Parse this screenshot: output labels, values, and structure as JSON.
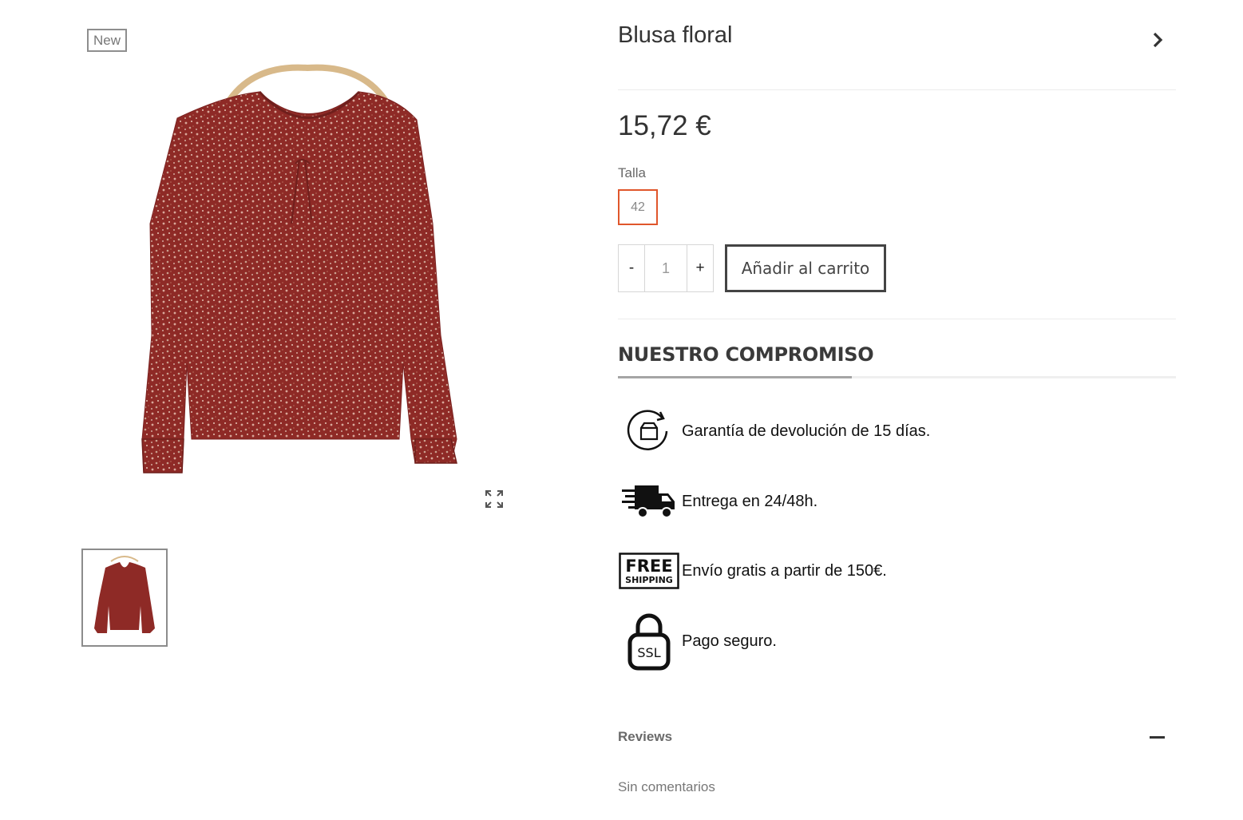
{
  "gallery": {
    "badge": "New"
  },
  "product": {
    "title": "Blusa floral",
    "price": "15,72 €",
    "size_label": "Talla",
    "sizes": [
      "42"
    ],
    "selected_size": "42",
    "quantity": {
      "minus": "-",
      "value": "1",
      "plus": "+"
    },
    "add_to_cart": "Añadir al carrito"
  },
  "commitment": {
    "title": "NUESTRO COMPROMISO",
    "items": [
      {
        "icon": "return-box-icon",
        "text": "Garantía de devolución de 15 días."
      },
      {
        "icon": "delivery-truck-icon",
        "text": "Entrega en 24/48h."
      },
      {
        "icon": "free-shipping-icon",
        "icon_text": [
          "FREE",
          "SHIPPING"
        ],
        "text": "Envío gratis a partir de 150€."
      },
      {
        "icon": "ssl-lock-icon",
        "icon_text": [
          "SSL"
        ],
        "text": "Pago seguro."
      }
    ]
  },
  "reviews": {
    "label": "Reviews",
    "empty_text": "Sin comentarios"
  },
  "colors": {
    "accent": "#e0562b",
    "blouse": "#8e2a26"
  }
}
